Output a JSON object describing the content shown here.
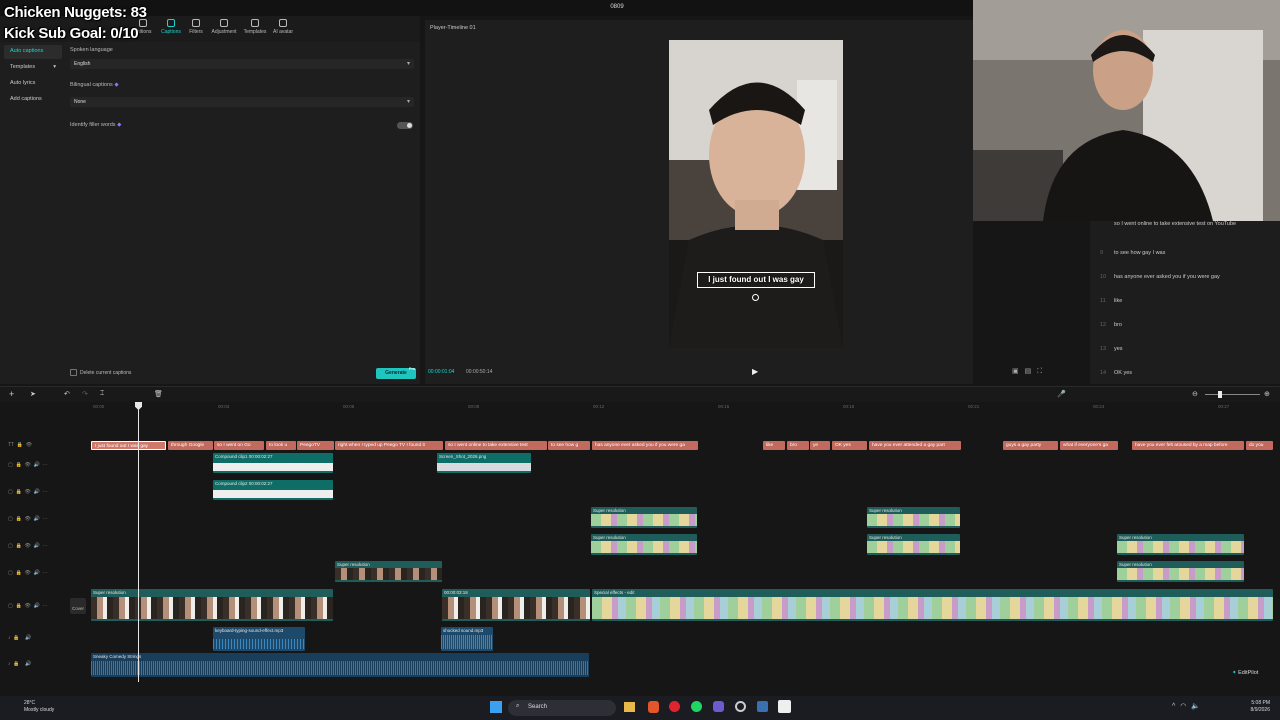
{
  "overlay": {
    "line1": "Chicken Nuggets: 83",
    "line2": "Kick Sub Goal: 0/10"
  },
  "window": {
    "title": "0809"
  },
  "toolbar": {
    "tabs": [
      {
        "label": "nsitions",
        "icon": "transitions-icon",
        "active": false
      },
      {
        "label": "Captions",
        "icon": "captions-icon",
        "active": true
      },
      {
        "label": "Filters",
        "icon": "filters-icon",
        "active": false
      },
      {
        "label": "Adjustment",
        "icon": "adjustment-icon",
        "active": false
      },
      {
        "label": "Templates",
        "icon": "templates-icon",
        "active": false
      },
      {
        "label": "AI avatar",
        "icon": "avatar-icon",
        "active": false
      }
    ]
  },
  "left_nav": [
    "Auto captions",
    "Templates",
    "Auto lyrics",
    "Add captions"
  ],
  "captions_panel": {
    "spoken_language_label": "Spoken language",
    "spoken_language_value": "English",
    "bilingual_label": "Bilingual captions",
    "bilingual_value": "None",
    "filler_label": "Identify filler words",
    "delete_label": "Delete current captions",
    "generate_label": "Generate",
    "generate_badge": "Pro"
  },
  "player": {
    "title": "Player-Timeline 01",
    "caption": "I just found out I was gay",
    "current_time": "00:00:01:04",
    "total_time": "00:00:50:14"
  },
  "transcript": [
    {
      "n": "",
      "text": "so I went online to take extensive test on YouTube"
    },
    {
      "n": "9",
      "text": "to see how gay I was"
    },
    {
      "n": "10",
      "text": "has anyone ever asked you if you were gay"
    },
    {
      "n": "11",
      "text": "like"
    },
    {
      "n": "12",
      "text": "bro"
    },
    {
      "n": "13",
      "text": "yes"
    },
    {
      "n": "14",
      "text": "OK yes"
    }
  ],
  "ruler": [
    "00:00",
    "00:03",
    "00:06",
    "00:09",
    "00:12",
    "00:15",
    "00:18",
    "00:21",
    "00:24",
    "00:27"
  ],
  "caption_clips": [
    "I just found out I was gay",
    "through Google",
    "so I went on Go",
    "to look u",
    "PeegoTV",
    "right when I typed up Peego TV I found it",
    "so I went online to take extensive test",
    "to see how g",
    "has anyone ever asked you if you were ga",
    "like",
    "bro",
    "ye",
    "OK yes",
    "have you ever attended a gay part",
    "guys a gay party",
    "what if everyone's ga",
    "have you ever felt aroused by a map before",
    "do you"
  ],
  "clips": {
    "compound1": "Compound clip1  00:00:02:27",
    "compound2": "Compound clip2  00:00:02:27",
    "compound3": "Compound",
    "image": "Screen_Shot_2026.png",
    "superres": "Super resolution",
    "superres_date": "2026-08-09 ... 0.mov",
    "special": "Special effects - edit",
    "cover": "Cover",
    "keyboard": "keyboard-typing-sound-effect.mp3",
    "shocked": "shocked sound.mp3",
    "music": "Sneaky Comedy Strings",
    "main_time": "00:00:03:18"
  },
  "editpilot": "EditPilot",
  "taskbar": {
    "weather_temp": "28°C",
    "weather_desc": "Mostly cloudy",
    "search": "Search",
    "time": "5:08 PM",
    "date": "8/9/2026"
  }
}
